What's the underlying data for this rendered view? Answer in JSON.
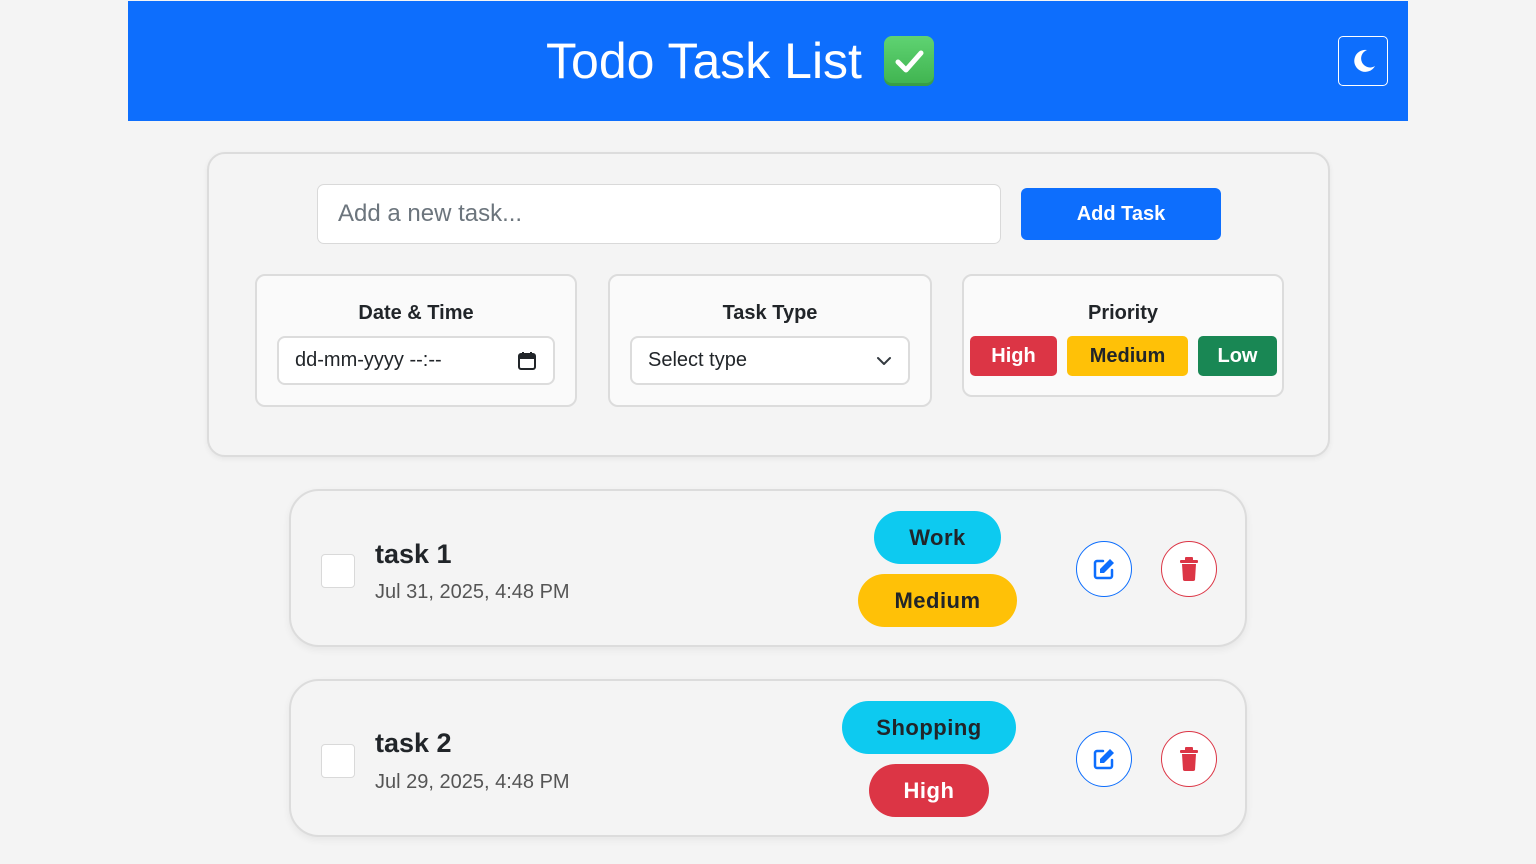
{
  "header": {
    "title": "Todo Task List",
    "emoji": "check-mark-button-icon",
    "theme_toggle_icon": "moon-icon"
  },
  "form": {
    "input_placeholder": "Add a new task...",
    "add_button": "Add Task",
    "datetime": {
      "label": "Date & Time",
      "placeholder": "dd-mm-yyyy --:--"
    },
    "task_type": {
      "label": "Task Type",
      "selected": "Select type"
    },
    "priority": {
      "label": "Priority",
      "options": [
        {
          "label": "High",
          "color": "#dc3545"
        },
        {
          "label": "Medium",
          "color": "#ffc107"
        },
        {
          "label": "Low",
          "color": "#198754"
        }
      ]
    }
  },
  "tasks": [
    {
      "name": "task 1",
      "date": "Jul 31, 2025, 4:48 PM",
      "type": "Work",
      "priority": "Medium",
      "type_color": "#0dcaf0",
      "priority_color": "#ffc107"
    },
    {
      "name": "task 2",
      "date": "Jul 29, 2025, 4:48 PM",
      "type": "Shopping",
      "priority": "High",
      "type_color": "#0dcaf0",
      "priority_color": "#dc3545"
    }
  ],
  "colors": {
    "primary": "#0d6efd",
    "danger": "#dc3545",
    "warning": "#ffc107",
    "success": "#198754",
    "info": "#0dcaf0"
  }
}
